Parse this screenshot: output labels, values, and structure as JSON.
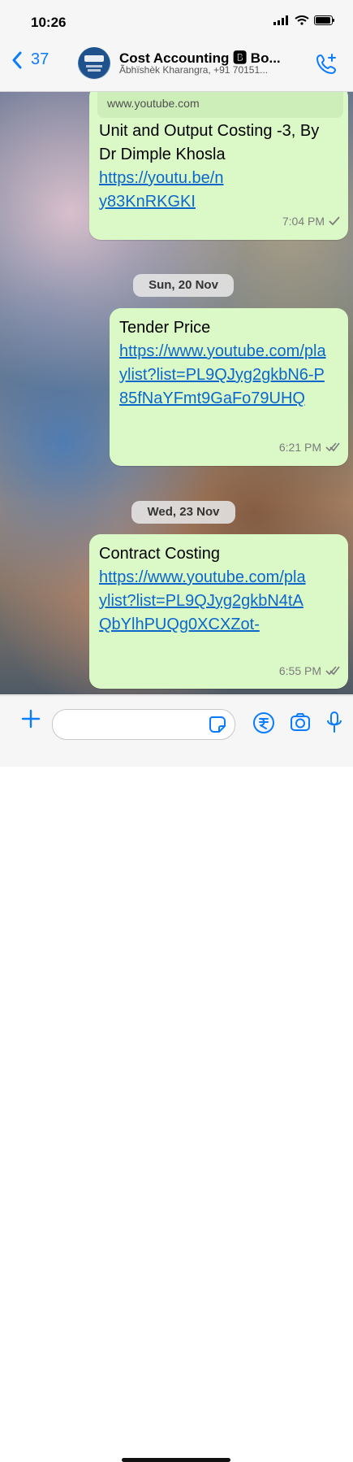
{
  "status_bar": {
    "time": "10:26"
  },
  "header": {
    "back_count": "37",
    "title": "Cost Accounting 🅱 Bo...",
    "subtitle": "Ãbhïshèk Kharangra, +91 70151..."
  },
  "messages": [
    {
      "preview_url": "www.youtube.com",
      "text": "Unit and Output Costing -3, By Dr  Dimple Khosla",
      "link": "https://youtu.be/ny83KnRKGKI",
      "time": "7:04 PM"
    },
    {
      "date": "Sun, 20 Nov",
      "text": "Tender Price",
      "link": "https://www.youtube.com/playlist?list=PL9QJyg2gkbN6-P85fNaYFmt9GaFo79UHQ",
      "time": "6:21 PM"
    },
    {
      "date": "Wed, 23 Nov",
      "text": "Contract Costing",
      "link": "https://www.youtube.com/playlist?list=PL9QJyg2gkbN4tAQbYlhPUQg0XCXZot-",
      "time": "6:55 PM"
    }
  ],
  "composer": {
    "value": "",
    "placeholder": ""
  },
  "colors": {
    "accent": "#0a7cff",
    "bubble": "#dbf8c7",
    "link": "#0b67cc",
    "read_tick": "#7b7b7b"
  },
  "icons": {
    "back": "chevron-left-icon",
    "call": "phone-plus-icon",
    "attach": "plus-icon",
    "sticker": "sticker-icon",
    "payment": "rupee-icon",
    "camera": "camera-icon",
    "voice": "mic-icon",
    "scroll": "chevron-down-icon"
  }
}
